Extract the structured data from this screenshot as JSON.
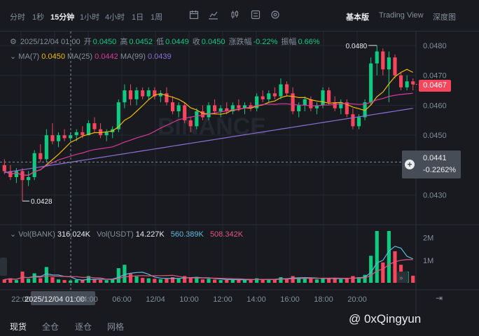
{
  "toolbar": {
    "timeframes": [
      "分时",
      "1秒",
      "15分钟",
      "1小时",
      "4小时",
      "1日",
      "1周"
    ],
    "views": [
      "基本版",
      "Trading View",
      "深度图"
    ]
  },
  "ohlc": {
    "datetime": "2025/12/04 01:00",
    "open_label": "开",
    "open": "0.0450",
    "high_label": "高",
    "high": "0.0452",
    "low_label": "低",
    "low": "0.0449",
    "close_label": "收",
    "close": "0.0450",
    "change_label": "涨跌幅",
    "change": "-0.22%",
    "amp_label": "振幅",
    "amp": "0.66%"
  },
  "ma": {
    "ma7_label": "MA(7)",
    "ma7": "0.0450",
    "ma25_label": "MA(25)",
    "ma25": "0.0442",
    "ma99_label": "MA(99)",
    "ma99": "0.0439"
  },
  "volume": {
    "vol_bank_label": "Vol(BANK)",
    "vol_bank": "316.024K",
    "vol_usdt_label": "Vol(USDT)",
    "vol_usdt": "14.227K",
    "ma_a": "560.389K",
    "ma_b": "508.342K",
    "axis": [
      "2M",
      "1M"
    ]
  },
  "price_axis": [
    "0.0480",
    "0.0470",
    "0.0460",
    "0.0450",
    "0.0440",
    "0.0430"
  ],
  "price_markers": {
    "high_marker": "0.0480",
    "low_marker": "0.0428",
    "current_price": "0.0467",
    "crosshair_price": "0.0441",
    "crosshair_pct": "-0.2262%"
  },
  "time_axis": [
    "22:00",
    "2025/12/04 01:00",
    "04:00",
    "06:00",
    "12/04",
    "10:00",
    "12:00",
    "14:00",
    "16:00",
    "18:00",
    "20:00"
  ],
  "bottom_tabs": [
    "现货",
    "全仓",
    "逐仓",
    "网格"
  ],
  "watermark": "@ 0xQingyun",
  "brand_watermark": "BINANCE",
  "colors": {
    "up": "#0ecb81",
    "down": "#f6465d",
    "ma7": "#f0b90b",
    "ma25": "#d6399a",
    "ma99": "#8c6fd6",
    "bg": "#181a20"
  },
  "chart_data": {
    "type": "candlestick",
    "symbol_unit": "USDT",
    "interval": "15m",
    "candles": [
      {
        "o": 0.044,
        "h": 0.0442,
        "l": 0.0437,
        "c": 0.0438,
        "v": 150
      },
      {
        "o": 0.0438,
        "h": 0.044,
        "l": 0.0435,
        "c": 0.0436,
        "v": 200
      },
      {
        "o": 0.0436,
        "h": 0.0439,
        "l": 0.0434,
        "c": 0.0438,
        "v": 120
      },
      {
        "o": 0.0438,
        "h": 0.0439,
        "l": 0.0428,
        "c": 0.0435,
        "v": 500
      },
      {
        "o": 0.0435,
        "h": 0.0438,
        "l": 0.0433,
        "c": 0.0436,
        "v": 180
      },
      {
        "o": 0.0436,
        "h": 0.0445,
        "l": 0.0435,
        "c": 0.0444,
        "v": 420
      },
      {
        "o": 0.0444,
        "h": 0.0447,
        "l": 0.0441,
        "c": 0.0442,
        "v": 200
      },
      {
        "o": 0.0442,
        "h": 0.0452,
        "l": 0.0441,
        "c": 0.045,
        "v": 700
      },
      {
        "o": 0.045,
        "h": 0.0454,
        "l": 0.0447,
        "c": 0.0448,
        "v": 250
      },
      {
        "o": 0.0448,
        "h": 0.0451,
        "l": 0.0446,
        "c": 0.045,
        "v": 150
      },
      {
        "o": 0.045,
        "h": 0.0452,
        "l": 0.0448,
        "c": 0.0449,
        "v": 120
      },
      {
        "o": 0.0449,
        "h": 0.0451,
        "l": 0.0448,
        "c": 0.045,
        "v": 100
      },
      {
        "o": 0.045,
        "h": 0.0452,
        "l": 0.0448,
        "c": 0.0451,
        "v": 130
      },
      {
        "o": 0.0451,
        "h": 0.0453,
        "l": 0.0449,
        "c": 0.045,
        "v": 110
      },
      {
        "o": 0.045,
        "h": 0.0455,
        "l": 0.045,
        "c": 0.0454,
        "v": 300
      },
      {
        "o": 0.0454,
        "h": 0.0456,
        "l": 0.0451,
        "c": 0.0452,
        "v": 140
      },
      {
        "o": 0.0452,
        "h": 0.0454,
        "l": 0.0449,
        "c": 0.045,
        "v": 130
      },
      {
        "o": 0.045,
        "h": 0.0452,
        "l": 0.0448,
        "c": 0.0451,
        "v": 120
      },
      {
        "o": 0.0451,
        "h": 0.0453,
        "l": 0.0449,
        "c": 0.0452,
        "v": 150
      },
      {
        "o": 0.0452,
        "h": 0.0462,
        "l": 0.0451,
        "c": 0.0461,
        "v": 650
      },
      {
        "o": 0.0461,
        "h": 0.0467,
        "l": 0.0459,
        "c": 0.0465,
        "v": 800
      },
      {
        "o": 0.0465,
        "h": 0.0467,
        "l": 0.046,
        "c": 0.0462,
        "v": 400
      },
      {
        "o": 0.0462,
        "h": 0.0466,
        "l": 0.046,
        "c": 0.0465,
        "v": 280
      },
      {
        "o": 0.0465,
        "h": 0.0466,
        "l": 0.0462,
        "c": 0.0463,
        "v": 220
      },
      {
        "o": 0.0463,
        "h": 0.0466,
        "l": 0.0462,
        "c": 0.0465,
        "v": 200
      },
      {
        "o": 0.0465,
        "h": 0.0466,
        "l": 0.0462,
        "c": 0.0463,
        "v": 180
      },
      {
        "o": 0.0463,
        "h": 0.0465,
        "l": 0.0461,
        "c": 0.0464,
        "v": 160
      },
      {
        "o": 0.0464,
        "h": 0.0466,
        "l": 0.046,
        "c": 0.0461,
        "v": 200
      },
      {
        "o": 0.0461,
        "h": 0.0463,
        "l": 0.0457,
        "c": 0.0458,
        "v": 250
      },
      {
        "o": 0.0458,
        "h": 0.0461,
        "l": 0.0456,
        "c": 0.046,
        "v": 180
      },
      {
        "o": 0.046,
        "h": 0.0461,
        "l": 0.0454,
        "c": 0.0455,
        "v": 300
      },
      {
        "o": 0.0455,
        "h": 0.0456,
        "l": 0.0451,
        "c": 0.0453,
        "v": 220
      },
      {
        "o": 0.0453,
        "h": 0.0459,
        "l": 0.0452,
        "c": 0.0458,
        "v": 260
      },
      {
        "o": 0.0458,
        "h": 0.046,
        "l": 0.0455,
        "c": 0.0456,
        "v": 150
      },
      {
        "o": 0.0456,
        "h": 0.0461,
        "l": 0.0455,
        "c": 0.046,
        "v": 180
      },
      {
        "o": 0.046,
        "h": 0.0462,
        "l": 0.0457,
        "c": 0.0458,
        "v": 140
      },
      {
        "o": 0.0458,
        "h": 0.046,
        "l": 0.0456,
        "c": 0.0459,
        "v": 120
      },
      {
        "o": 0.0459,
        "h": 0.0461,
        "l": 0.0457,
        "c": 0.0458,
        "v": 130
      },
      {
        "o": 0.0458,
        "h": 0.0461,
        "l": 0.0457,
        "c": 0.046,
        "v": 150
      },
      {
        "o": 0.046,
        "h": 0.0462,
        "l": 0.0458,
        "c": 0.0459,
        "v": 140
      },
      {
        "o": 0.0459,
        "h": 0.0461,
        "l": 0.0457,
        "c": 0.046,
        "v": 130
      },
      {
        "o": 0.046,
        "h": 0.0461,
        "l": 0.0458,
        "c": 0.0459,
        "v": 120
      },
      {
        "o": 0.0459,
        "h": 0.0464,
        "l": 0.0458,
        "c": 0.0463,
        "v": 200
      },
      {
        "o": 0.0463,
        "h": 0.0465,
        "l": 0.0461,
        "c": 0.0462,
        "v": 150
      },
      {
        "o": 0.0462,
        "h": 0.0465,
        "l": 0.0461,
        "c": 0.0464,
        "v": 160
      },
      {
        "o": 0.0464,
        "h": 0.0466,
        "l": 0.0462,
        "c": 0.0463,
        "v": 140
      },
      {
        "o": 0.0463,
        "h": 0.0469,
        "l": 0.0462,
        "c": 0.0467,
        "v": 250
      },
      {
        "o": 0.0467,
        "h": 0.0468,
        "l": 0.0463,
        "c": 0.0464,
        "v": 200
      },
      {
        "o": 0.0464,
        "h": 0.0466,
        "l": 0.0457,
        "c": 0.0458,
        "v": 300
      },
      {
        "o": 0.0458,
        "h": 0.0461,
        "l": 0.0456,
        "c": 0.046,
        "v": 220
      },
      {
        "o": 0.046,
        "h": 0.0463,
        "l": 0.0458,
        "c": 0.0462,
        "v": 180
      },
      {
        "o": 0.0462,
        "h": 0.0463,
        "l": 0.0458,
        "c": 0.0459,
        "v": 200
      },
      {
        "o": 0.0459,
        "h": 0.0461,
        "l": 0.0457,
        "c": 0.046,
        "v": 150
      },
      {
        "o": 0.046,
        "h": 0.0466,
        "l": 0.0459,
        "c": 0.0465,
        "v": 220
      },
      {
        "o": 0.0465,
        "h": 0.0466,
        "l": 0.046,
        "c": 0.0461,
        "v": 200
      },
      {
        "o": 0.0461,
        "h": 0.0463,
        "l": 0.0458,
        "c": 0.0459,
        "v": 180
      },
      {
        "o": 0.0459,
        "h": 0.0462,
        "l": 0.0457,
        "c": 0.0461,
        "v": 160
      },
      {
        "o": 0.0461,
        "h": 0.0462,
        "l": 0.0456,
        "c": 0.0457,
        "v": 200
      },
      {
        "o": 0.0457,
        "h": 0.0459,
        "l": 0.0452,
        "c": 0.0453,
        "v": 300
      },
      {
        "o": 0.0453,
        "h": 0.0457,
        "l": 0.0452,
        "c": 0.0456,
        "v": 250
      },
      {
        "o": 0.0456,
        "h": 0.0462,
        "l": 0.0455,
        "c": 0.0461,
        "v": 350
      },
      {
        "o": 0.0461,
        "h": 0.0476,
        "l": 0.046,
        "c": 0.0474,
        "v": 1200
      },
      {
        "o": 0.0474,
        "h": 0.048,
        "l": 0.047,
        "c": 0.0478,
        "v": 2300
      },
      {
        "o": 0.0478,
        "h": 0.0479,
        "l": 0.047,
        "c": 0.0472,
        "v": 900
      },
      {
        "o": 0.0472,
        "h": 0.0478,
        "l": 0.0461,
        "c": 0.0476,
        "v": 2300
      },
      {
        "o": 0.0476,
        "h": 0.0477,
        "l": 0.0469,
        "c": 0.047,
        "v": 1400
      },
      {
        "o": 0.047,
        "h": 0.0471,
        "l": 0.0465,
        "c": 0.0466,
        "v": 800
      },
      {
        "o": 0.0466,
        "h": 0.047,
        "l": 0.0465,
        "c": 0.0468,
        "v": 500
      },
      {
        "o": 0.0468,
        "h": 0.0469,
        "l": 0.0465,
        "c": 0.0467,
        "v": 316
      }
    ],
    "ylim": [
      0.0425,
      0.04835
    ],
    "vol_ylim": [
      0,
      2300
    ]
  }
}
